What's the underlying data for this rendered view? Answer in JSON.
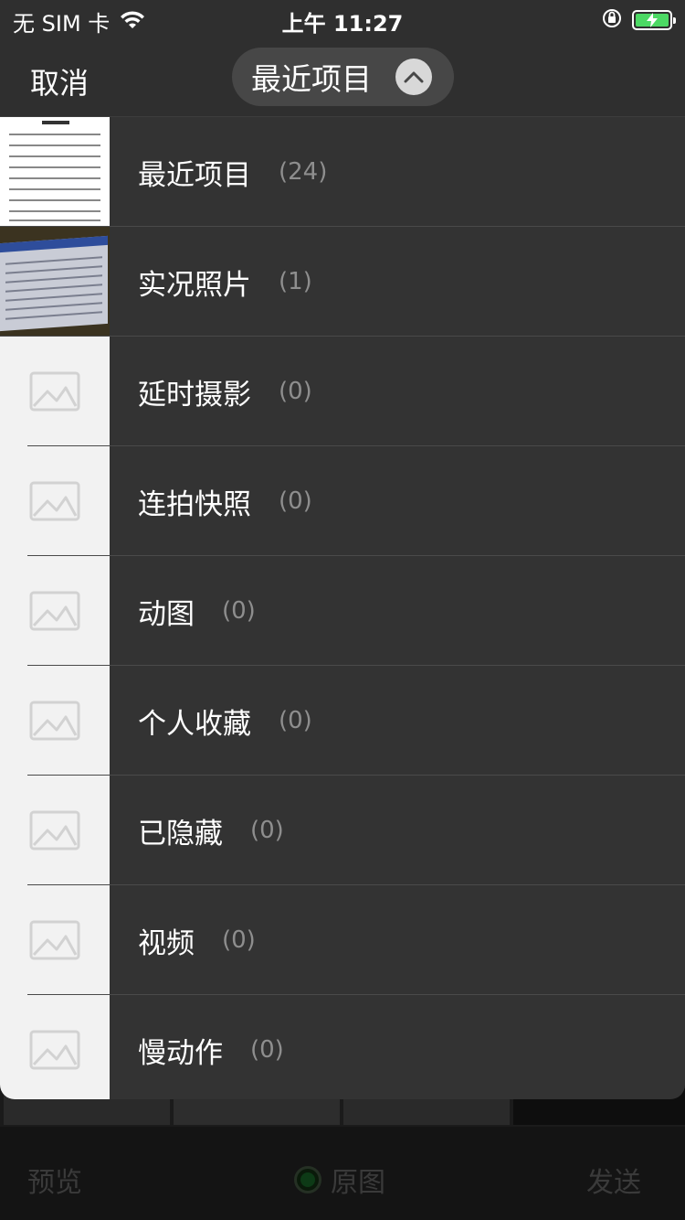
{
  "status_bar": {
    "carrier": "无 SIM 卡",
    "time": "上午 11:27",
    "icons": [
      "wifi-icon",
      "orientation-lock-icon",
      "battery-charging-icon"
    ]
  },
  "nav": {
    "cancel_label": "取消",
    "album_selector_label": "最近项目"
  },
  "albums": [
    {
      "name": "最近项目",
      "count": "(24)",
      "thumb": "document-photo"
    },
    {
      "name": "实况照片",
      "count": "(1)",
      "thumb": "screen-photo"
    },
    {
      "name": "延时摄影",
      "count": "(0)",
      "thumb": "placeholder-image-icon"
    },
    {
      "name": "连拍快照",
      "count": "(0)",
      "thumb": "placeholder-image-icon"
    },
    {
      "name": "动图",
      "count": "(0)",
      "thumb": "placeholder-image-icon"
    },
    {
      "name": "个人收藏",
      "count": "(0)",
      "thumb": "placeholder-image-icon"
    },
    {
      "name": "已隐藏",
      "count": "(0)",
      "thumb": "placeholder-image-icon"
    },
    {
      "name": "视频",
      "count": "(0)",
      "thumb": "placeholder-image-icon"
    },
    {
      "name": "慢动作",
      "count": "(0)",
      "thumb": "placeholder-image-icon"
    }
  ],
  "bottom_bar": {
    "preview_label": "预览",
    "original_label": "原图",
    "send_label": "发送"
  },
  "colors": {
    "panel_bg": "#333333",
    "nav_bg": "#2f2f2f",
    "pill_bg": "#474747",
    "count_text": "#8e8e8e",
    "battery_green": "#4cd964"
  }
}
